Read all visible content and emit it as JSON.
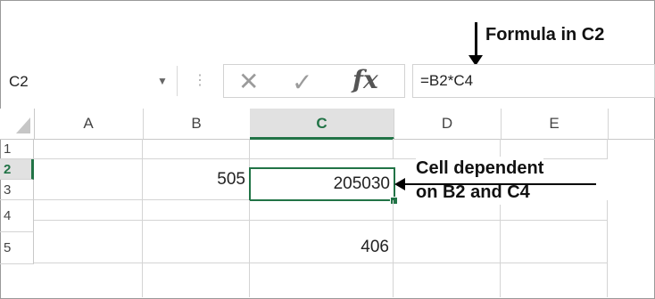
{
  "annotations": {
    "formula_note": "Formula in C2",
    "dependent_note_line1": "Cell dependent",
    "dependent_note_line2": "on B2 and C4"
  },
  "formula_bar": {
    "name_box": "C2",
    "separator": "⋮",
    "cancel_glyph": "✕",
    "enter_glyph": "✓",
    "fx_glyph": "fx",
    "formula": "=B2*C4"
  },
  "grid": {
    "columns": [
      "A",
      "B",
      "C",
      "D",
      "E"
    ],
    "rows": [
      "1",
      "2",
      "3",
      "4",
      "5"
    ],
    "cells": {
      "B2": "505",
      "C2": "205030",
      "C4": "406"
    },
    "active_cell": "C2"
  },
  "colors": {
    "accent": "#217346",
    "header_selected_bg": "#e1e1e1"
  }
}
